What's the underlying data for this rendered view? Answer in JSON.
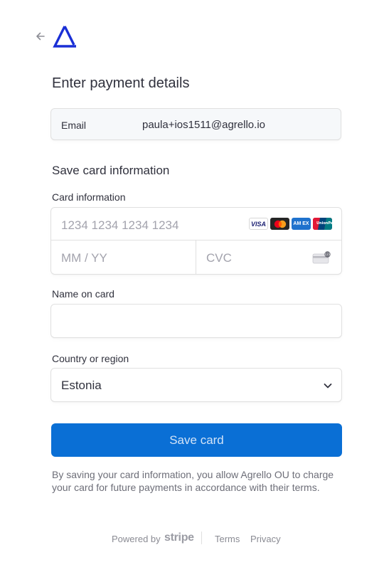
{
  "header": {
    "back_icon": "arrow-left-icon",
    "logo_icon": "agrello-triangle-logo",
    "title": "Enter payment details"
  },
  "email": {
    "label": "Email",
    "value": "paula+ios1511@agrello.io"
  },
  "section_title": "Save card information",
  "card": {
    "label": "Card information",
    "number_placeholder": "1234 1234 1234 1234",
    "expiry_placeholder": "MM / YY",
    "cvc_placeholder": "CVC",
    "brands": [
      "VISA",
      "Mastercard",
      "AMEX",
      "UnionPay"
    ]
  },
  "name_on_card": {
    "label": "Name on card",
    "value": ""
  },
  "country": {
    "label": "Country or region",
    "selected": "Estonia"
  },
  "save_button": {
    "label": "Save card",
    "color": "#0a6fd5"
  },
  "disclaimer": "By saving your card information, you allow Agrello OU to charge your card for future payments in accordance with their terms.",
  "footer": {
    "powered_by": "Powered by",
    "brand": "stripe",
    "terms": "Terms",
    "privacy": "Privacy"
  }
}
